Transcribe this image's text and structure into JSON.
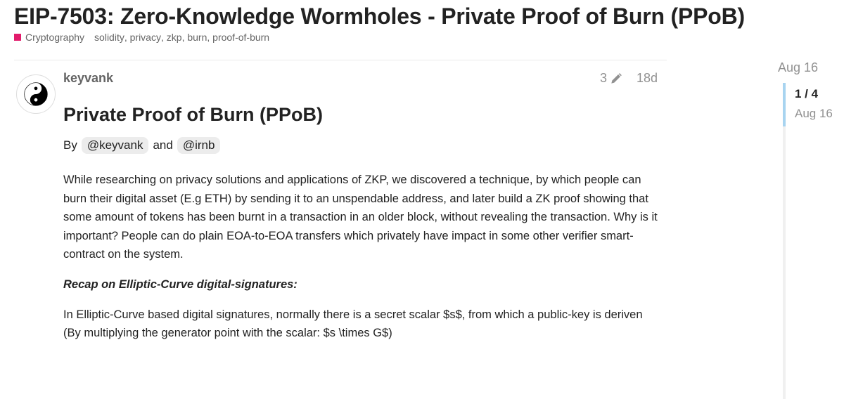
{
  "topic": {
    "title": "EIP-7503: Zero-Knowledge Wormholes - Private Proof of Burn (PPoB)",
    "category": "Cryptography",
    "category_color": "#e21b6b",
    "tags": [
      "solidity",
      "privacy",
      "zkp",
      "burn",
      "proof-of-burn"
    ]
  },
  "post": {
    "author": "keyvank",
    "avatar_icon": "yin-yang-icon",
    "edit_count": "3",
    "edit_icon": "pencil-icon",
    "age": "18d",
    "heading": "Private Proof of Burn (PPoB)",
    "byline_prefix": "By",
    "mention1": "@keyvank",
    "byline_and": "and",
    "mention2": "@irnb",
    "paragraph1": "While researching on privacy solutions and applications of ZKP, we discovered a technique, by which people can burn their digital asset (E.g ETH) by sending it to an unspendable address, and later build a ZK proof showing that some amount of tokens has been burnt in a transaction in an older block, without revealing the transaction. Why is it important? People can do plain EOA-to-EOA transfers which privately have impact in some other verifier smart-contract on the system.",
    "recap_heading": "Recap on Elliptic-Curve digital-signatures:",
    "paragraph2": "In Elliptic-Curve based digital signatures, normally there is a secret scalar $s$, from which a public-key is deriven (By multiplying the generator point with the scalar: $s \\times G$)"
  },
  "timeline": {
    "start_date": "Aug 16",
    "position": "1 / 4",
    "current_date": "Aug 16",
    "progress_fraction": 0.25
  }
}
